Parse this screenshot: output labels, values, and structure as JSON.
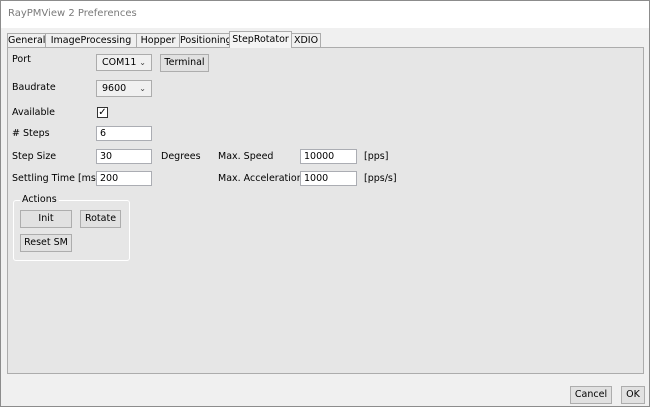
{
  "window": {
    "title": "RayPMView 2 Preferences"
  },
  "tabs": [
    "General",
    "ImageProcessing",
    "Hopper",
    "Positioning",
    "StepRotator",
    "XDIO"
  ],
  "active_tab": "StepRotator",
  "form": {
    "port": {
      "label": "Port",
      "value": "COM11",
      "terminal_button": "Terminal"
    },
    "baudrate": {
      "label": "Baudrate",
      "value": "9600"
    },
    "available": {
      "label": "Available",
      "checked": true,
      "mark": "✓"
    },
    "steps": {
      "label": "# Steps",
      "value": "6"
    },
    "step_size": {
      "label": "Step Size",
      "value": "30",
      "unit": "Degrees"
    },
    "settling_time": {
      "label": "Settling Time [ms]",
      "value": "200"
    },
    "max_speed": {
      "label": "Max. Speed",
      "value": "10000",
      "unit": "[pps]"
    },
    "max_acceleration": {
      "label": "Max. Acceleration",
      "value": "1000",
      "unit": "[pps/s]"
    }
  },
  "actions": {
    "title": "Actions",
    "init": "Init",
    "rotate": "Rotate",
    "reset": "Reset SM"
  },
  "footer": {
    "cancel": "Cancel",
    "ok": "OK"
  },
  "icons": {
    "dropdown": "chevron-down-icon",
    "checkbox": "checkmark-icon"
  }
}
